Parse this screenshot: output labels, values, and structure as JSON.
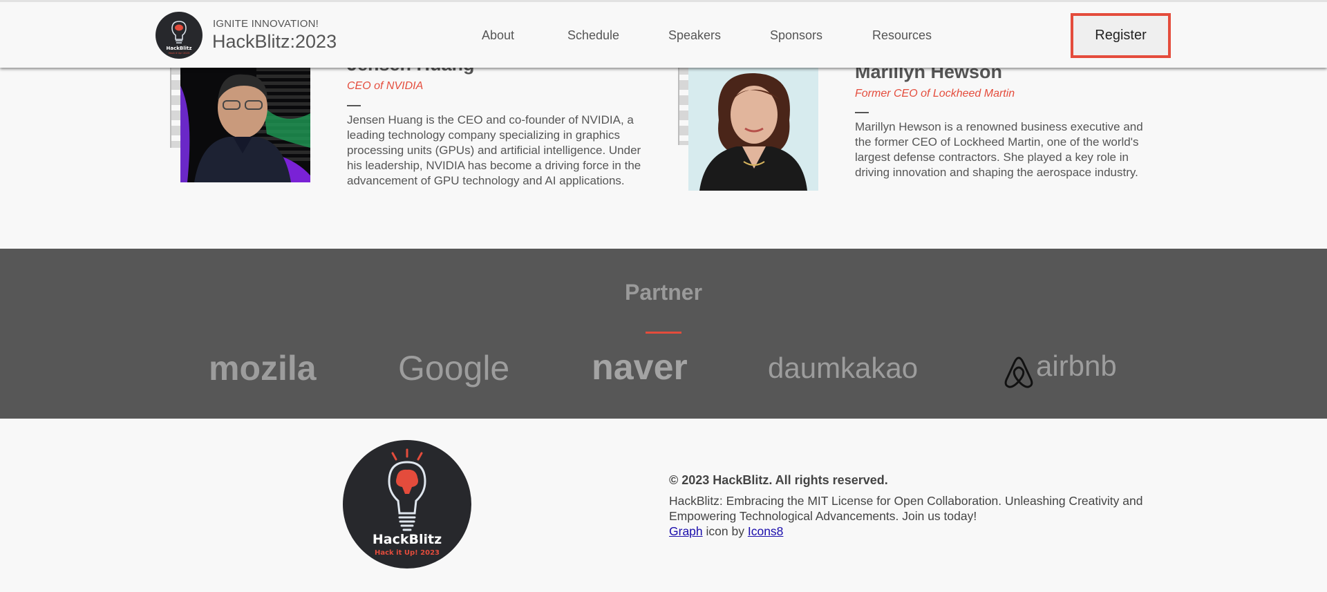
{
  "header": {
    "tagline": "IGNITE INNOVATION!",
    "title": "HackBlitz:2023",
    "nav": [
      "About",
      "Schedule",
      "Speakers",
      "Sponsors",
      "Resources"
    ],
    "register_label": "Register"
  },
  "speakers": [
    {
      "name": "Jensen Huang",
      "role": "CEO of NVIDIA",
      "bio": "Jensen Huang is the CEO and co-founder of NVIDIA, a leading technology company specializing in graphics processing units (GPUs) and artificial intelligence. Under his leadership, NVIDIA has become a driving force in the advancement of GPU technology and AI applications."
    },
    {
      "name": "Marillyn Hewson",
      "role": "Former CEO of Lockheed Martin",
      "bio": "Marillyn Hewson is a renowned business executive and the former CEO of Lockheed Martin, one of the world's largest defense contractors. She played a key role in driving innovation and shaping the aerospace industry."
    }
  ],
  "partner": {
    "title": "Partner",
    "logos": [
      "mozila",
      "Google",
      "naver",
      "daumkakao",
      "airbnb"
    ]
  },
  "logo": {
    "name": "HackBlitz",
    "slogan": "Hack it Up! 2023"
  },
  "footer": {
    "copyright": "© 2023 HackBlitz. All rights reserved.",
    "license": "HackBlitz: Embracing the MIT License for Open Collaboration. Unleashing Creativity and Empowering Technological Advancements. Join us today!",
    "credit_link1": "Graph",
    "credit_mid": "icon by",
    "credit_link2": "Icons8"
  },
  "colors": {
    "accent": "#e44c3c",
    "partner_bg": "#575757",
    "page_bg": "#f8f8f8",
    "logo_bg": "#27282c"
  }
}
